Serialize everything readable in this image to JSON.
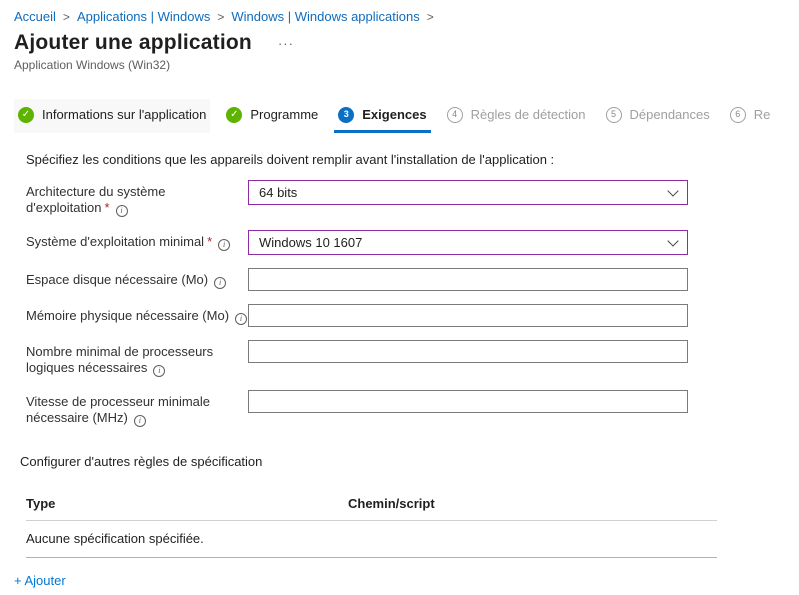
{
  "breadcrumb": {
    "separator": ">",
    "items": [
      {
        "label": "Accueil"
      },
      {
        "label": "Applications | Windows"
      },
      {
        "label": "Windows | Windows applications"
      }
    ]
  },
  "header": {
    "title": "Ajouter une application",
    "more_label": "···",
    "subtitle": "Application Windows (Win32)"
  },
  "steps": [
    {
      "id": "app-information",
      "label": "Informations sur l'application",
      "status": "done"
    },
    {
      "id": "program",
      "label": "Programme",
      "status": "done"
    },
    {
      "id": "requirements",
      "label": "Exigences",
      "status": "active",
      "number": "3"
    },
    {
      "id": "detection-rules",
      "label": "Règles de détection",
      "status": "todo",
      "number": "4"
    },
    {
      "id": "dependencies",
      "label": "Dépendances",
      "status": "todo",
      "number": "5"
    },
    {
      "id": "supersedence",
      "label": "Re",
      "status": "todo",
      "number": "6"
    }
  ],
  "description": "Spécifiez les conditions que les appareils doivent remplir avant l'installation de l'application :",
  "form": {
    "required_marker": "*",
    "fields": [
      {
        "id": "os-architecture",
        "label": "Architecture du système d'exploitation",
        "required": true,
        "type": "select",
        "value": "64 bits"
      },
      {
        "id": "minimum-os",
        "label": "Système d'exploitation minimal",
        "required": true,
        "type": "select",
        "value": "Windows 10 1607"
      },
      {
        "id": "disk-space",
        "label": "Espace disque nécessaire (Mo)",
        "required": false,
        "type": "text",
        "value": ""
      },
      {
        "id": "physical-memory",
        "label": "Mémoire physique nécessaire (Mo)",
        "required": false,
        "type": "text",
        "value": ""
      },
      {
        "id": "logical-processors",
        "label": "Nombre minimal de processeurs logiques nécessaires",
        "required": false,
        "type": "text",
        "value": ""
      },
      {
        "id": "cpu-speed",
        "label": "Vitesse de processeur minimale nécessaire (MHz)",
        "required": false,
        "type": "text",
        "value": ""
      }
    ]
  },
  "rules_section": {
    "heading": "Configurer d'autres règles de spécification",
    "table": {
      "columns": [
        "Type",
        "Chemin/script"
      ],
      "empty_message": "Aucune spécification spécifiée."
    },
    "add_link": "+ Ajouter"
  },
  "icons": {
    "check": "✓",
    "info": "i"
  },
  "colors": {
    "link_blue": "#0f6cbd",
    "accent_blue": "#0b70c4",
    "success_green": "#5db300",
    "modified_purple": "#8f2aa5",
    "text_dark": "#201f1e",
    "text_gray": "#605e5c",
    "disabled_gray": "#a19f9d"
  }
}
